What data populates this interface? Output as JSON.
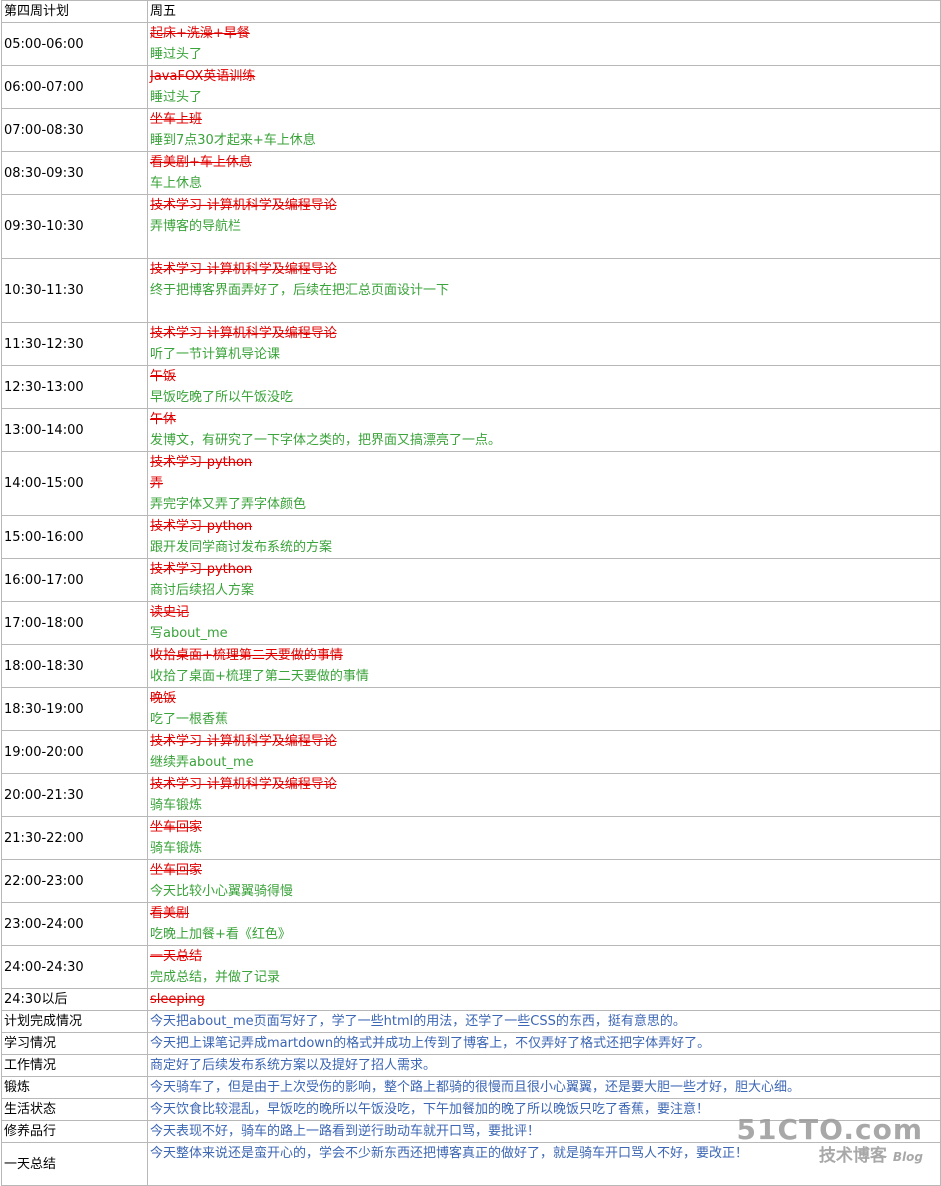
{
  "header": {
    "col1": "第四周计划",
    "col2": "周五"
  },
  "schedule": [
    {
      "time": "05:00-06:00",
      "plan": [
        "起床+洗澡+早餐"
      ],
      "done": "睡过头了",
      "h": 43
    },
    {
      "time": "06:00-07:00",
      "plan": [
        "JavaFOX英语训练"
      ],
      "done": "睡过头了",
      "h": 43
    },
    {
      "time": "07:00-08:30",
      "plan": [
        "坐车上班"
      ],
      "done": "睡到7点30才起来+车上休息",
      "h": 43
    },
    {
      "time": "08:30-09:30",
      "plan": [
        "看美剧+车上休息"
      ],
      "done": "车上休息",
      "h": 43
    },
    {
      "time": "09:30-10:30",
      "plan": [
        "技术学习-计算机科学及编程导论"
      ],
      "done": "弄博客的导航栏",
      "h": 64
    },
    {
      "time": "10:30-11:30",
      "plan": [
        "技术学习-计算机科学及编程导论"
      ],
      "done": "终于把博客界面弄好了，后续在把汇总页面设计一下",
      "h": 64
    },
    {
      "time": "11:30-12:30",
      "plan": [
        "技术学习-计算机科学及编程导论"
      ],
      "done": "听了一节计算机导论课",
      "h": 43
    },
    {
      "time": "12:30-13:00",
      "plan": [
        "午饭"
      ],
      "done": "早饭吃晚了所以午饭没吃",
      "h": 43
    },
    {
      "time": "13:00-14:00",
      "plan": [
        "午休"
      ],
      "done": "发博文，有研究了一下字体之类的，把界面又搞漂亮了一点。",
      "h": 43
    },
    {
      "time": "14:00-15:00",
      "plan": [
        "技术学习-python",
        "弄"
      ],
      "done": "弄完字体又弄了弄字体颜色",
      "h": 64
    },
    {
      "time": "15:00-16:00",
      "plan": [
        "技术学习-python"
      ],
      "done": "跟开发同学商讨发布系统的方案",
      "h": 43
    },
    {
      "time": "16:00-17:00",
      "plan": [
        "技术学习-python"
      ],
      "done": "商讨后续招人方案",
      "h": 43
    },
    {
      "time": "17:00-18:00",
      "plan": [
        "读史记"
      ],
      "done": "写about_me",
      "h": 43
    },
    {
      "time": "18:00-18:30",
      "plan": [
        "收拾桌面+梳理第二天要做的事情"
      ],
      "done": "收拾了桌面+梳理了第二天要做的事情",
      "h": 43
    },
    {
      "time": "18:30-19:00",
      "plan": [
        "晚饭"
      ],
      "done": "吃了一根香蕉",
      "h": 43
    },
    {
      "time": "19:00-20:00",
      "plan": [
        "技术学习-计算机科学及编程导论"
      ],
      "done": "继续弄about_me",
      "h": 43
    },
    {
      "time": "20:00-21:30",
      "plan": [
        "技术学习-计算机科学及编程导论"
      ],
      "done": "骑车锻炼",
      "h": 43
    },
    {
      "time": "21:30-22:00",
      "plan": [
        "坐车回家"
      ],
      "done": "骑车锻炼",
      "h": 43
    },
    {
      "time": "22:00-23:00",
      "plan": [
        "坐车回家"
      ],
      "done": "今天比较小心翼翼骑得慢",
      "h": 43
    },
    {
      "time": "23:00-24:00",
      "plan": [
        "看美剧"
      ],
      "done": "吃晚上加餐+看《红色》",
      "h": 43
    },
    {
      "time": "24:00-24:30",
      "plan": [
        "一天总结"
      ],
      "done": "完成总结，并做了记录",
      "h": 43
    },
    {
      "time": "24:30以后",
      "plan": [
        "sleeping"
      ],
      "done": "",
      "h": 22
    }
  ],
  "summary": [
    {
      "label": "计划完成情况",
      "text": "今天把about_me页面写好了，学了一些html的用法，还学了一些CSS的东西，挺有意思的。",
      "h": 22
    },
    {
      "label": "学习情况",
      "text": "今天把上课笔记弄成martdown的格式并成功上传到了博客上，不仅弄好了格式还把字体弄好了。",
      "h": 22
    },
    {
      "label": "工作情况",
      "text": "商定好了后续发布系统方案以及提好了招人需求。",
      "h": 22
    },
    {
      "label": "锻炼",
      "text": "今天骑车了，但是由于上次受伤的影响，整个路上都骑的很慢而且很小心翼翼，还是要大胆一些才好，胆大心细。",
      "h": 22
    },
    {
      "label": "生活状态",
      "text": "今天饮食比较混乱，早饭吃的晚所以午饭没吃，下午加餐加的晚了所以晚饭只吃了香蕉，要注意！",
      "h": 22
    },
    {
      "label": "修养品行",
      "text": "今天表现不好，骑车的路上一路看到逆行助动车就开口骂，要批评！",
      "h": 22
    },
    {
      "label": "一天总结",
      "text": "今天整体来说还是蛮开心的，学会不少新东西还把博客真正的做好了，就是骑车开口骂人不好，要改正！",
      "h": 43
    }
  ],
  "watermark": {
    "main": "51CTO.com",
    "sub": "技术博客",
    "blog": "Blog"
  }
}
